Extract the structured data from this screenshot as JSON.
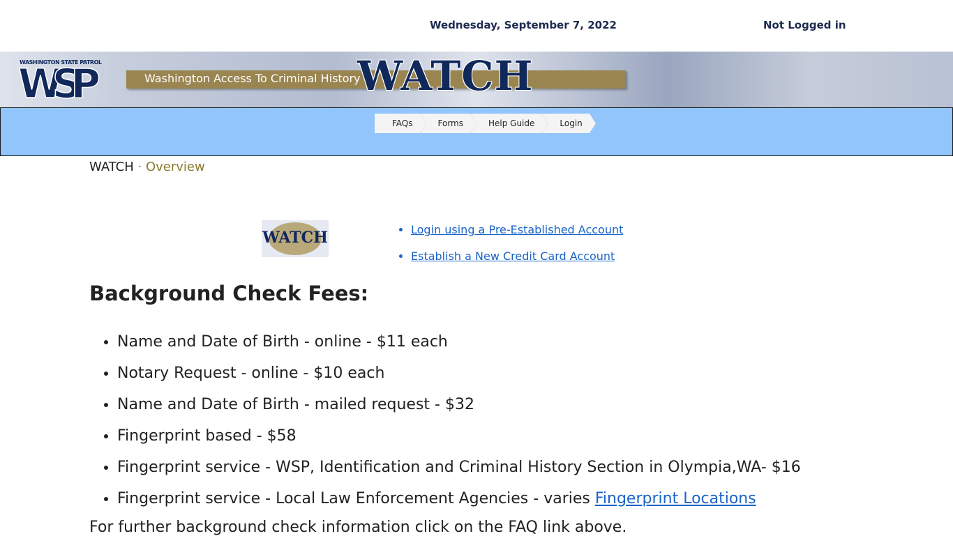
{
  "header": {
    "date": "Wednesday, September 7, 2022",
    "login_status": "Not Logged in"
  },
  "banner": {
    "logo_icon": "wsp-logo-icon",
    "agency_text": "WASHINGTON STATE PATROL",
    "logo_letters": "WSP",
    "subtitle": "Washington Access To Criminal History",
    "title": "WATCH",
    "colors": {
      "navy": "#10285a",
      "gold": "#9a8550",
      "nav_blue": "#92c5fb"
    }
  },
  "nav": {
    "items": [
      {
        "label": "FAQs"
      },
      {
        "label": "Forms"
      },
      {
        "label": "Help Guide"
      },
      {
        "label": "Login"
      }
    ]
  },
  "pathline": {
    "root": "WATCH",
    "separator": "·",
    "current": "Overview"
  },
  "mini_logo": {
    "text": "WATCH"
  },
  "account_links": [
    {
      "label": "Login using a Pre-Established Account"
    },
    {
      "label": "Establish a New Credit Card Account"
    }
  ],
  "fees": {
    "heading": "Background Check Fees:",
    "items": [
      "Name and Date of Birth - online - $11 each",
      "Notary Request - online - $10 each",
      "Name and Date of Birth - mailed request - $32",
      "Fingerprint based - $58",
      "Fingerprint service - WSP, Identification and Criminal History Section in Olympia,WA- $16",
      "Fingerprint service - Local Law Enforcement Agencies - varies "
    ],
    "fingerprint_link": "Fingerprint Locations",
    "further_info": "For further background check information click on the FAQ link above."
  }
}
